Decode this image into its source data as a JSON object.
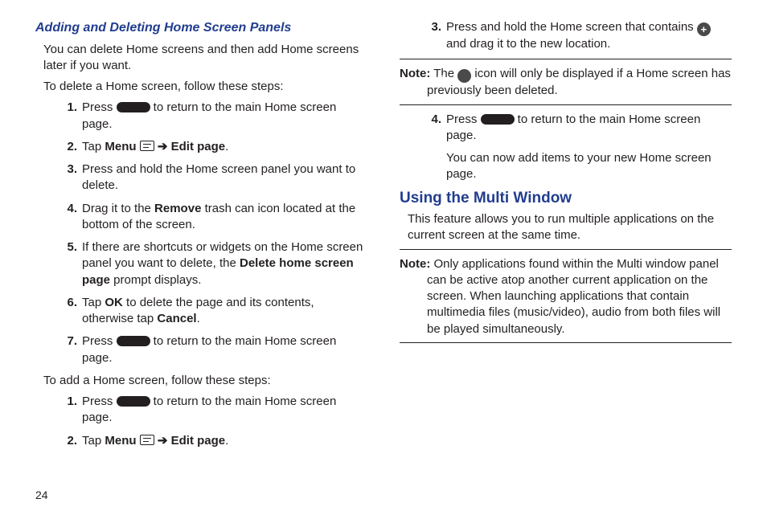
{
  "pageNumber": "24",
  "left": {
    "subhead": "Adding and Deleting Home Screen Panels",
    "intro": "You can delete Home screens and then add Home screens later if you want.",
    "leadDelete": "To delete a Home screen, follow these steps:",
    "deleteSteps": {
      "n1": "1.",
      "s1a": "Press ",
      "s1b": " to return to the main Home screen page.",
      "n2": "2.",
      "s2a": "Tap ",
      "menu": "Menu",
      "arrow": " ➔ ",
      "editpage": "Edit page",
      "s2b": ".",
      "n3": "3.",
      "s3": "Press and hold the Home screen panel you want to delete.",
      "n4": "4.",
      "s4a": "Drag it to the ",
      "remove": "Remove",
      "s4b": " trash can icon located at the bottom of the screen.",
      "n5": "5.",
      "s5a": "If there are shortcuts or widgets on the Home screen panel you want to delete, the ",
      "dhsp": "Delete home screen page",
      "s5b": " prompt displays.",
      "n6": "6.",
      "s6a": "Tap ",
      "ok": "OK",
      "s6b": " to delete the page and its contents, otherwise tap ",
      "cancel": "Cancel",
      "s6c": ".",
      "n7": "7.",
      "s7a": "Press ",
      "s7b": " to return to the main Home screen page."
    },
    "leadAdd": "To add a Home screen, follow these steps:",
    "addSteps": {
      "n1": "1.",
      "s1a": "Press ",
      "s1b": " to return to the main Home screen page.",
      "n2": "2.",
      "s2a": "Tap ",
      "menu": "Menu",
      "arrow": " ➔ ",
      "editpage": "Edit page",
      "s2b": "."
    }
  },
  "right": {
    "contSteps": {
      "n3": "3.",
      "s3a": "Press and hold the Home screen that contains ",
      "s3b": " and drag it to the new location."
    },
    "note1": {
      "label": "Note:",
      "a": " The ",
      "b": " icon will only be displayed if a Home screen has previously been deleted."
    },
    "step4": {
      "n4": "4.",
      "s4a": "Press ",
      "s4b": " to return to the main Home screen page.",
      "sub": "You can now add items to your new Home screen page."
    },
    "sect": "Using the Multi Window",
    "intro": "This feature allows you to run multiple applications on the current screen at the same time.",
    "note2": {
      "label": "Note:",
      "text": " Only applications found within the Multi window panel can be active atop another current application on the screen. When launching applications that contain multimedia files (music/video), audio from both files will be played simultaneously."
    }
  }
}
